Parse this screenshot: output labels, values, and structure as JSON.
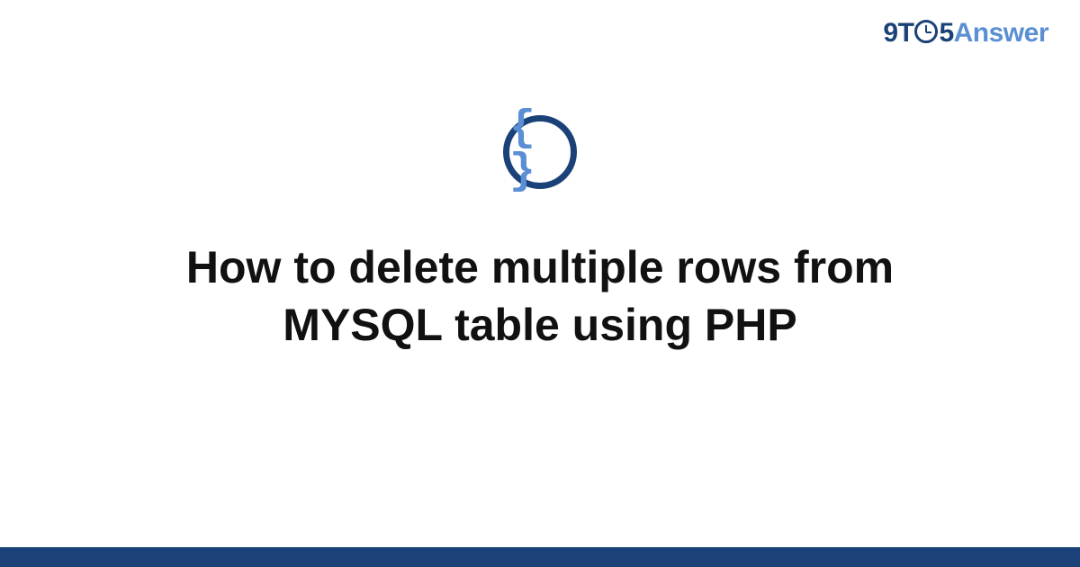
{
  "logo": {
    "part1": "9T",
    "part2": "5",
    "part3": "Answer"
  },
  "category": {
    "icon_name": "code-braces",
    "symbol": "{ }"
  },
  "title": "How to delete multiple rows from MYSQL table using PHP",
  "colors": {
    "brand_dark": "#1b4278",
    "brand_light": "#5a8fd4"
  }
}
